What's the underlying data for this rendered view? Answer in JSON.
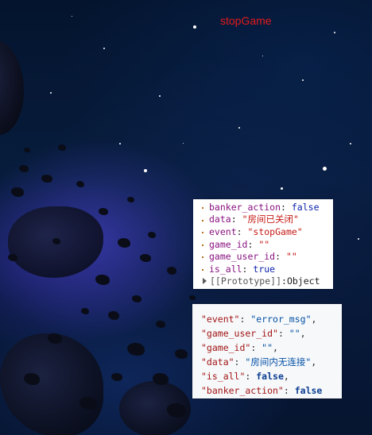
{
  "title": "stopGame",
  "console_object": {
    "rows": [
      {
        "key": "banker_action",
        "value": "false",
        "type": "bool"
      },
      {
        "key": "data",
        "value": "\"房间已关闭\"",
        "type": "str"
      },
      {
        "key": "event",
        "value": "\"stopGame\"",
        "type": "str"
      },
      {
        "key": "game_id",
        "value": "\"\"",
        "type": "str"
      },
      {
        "key": "game_user_id",
        "value": "\"\"",
        "type": "str"
      },
      {
        "key": "is_all",
        "value": "true",
        "type": "bool"
      }
    ],
    "prototype_label": "[[Prototype]]",
    "prototype_value": "Object"
  },
  "json_snippet": {
    "rows": [
      {
        "key": "\"event\"",
        "value": "\"error_msg\"",
        "type": "str",
        "trail": ","
      },
      {
        "key": "\"game_user_id\"",
        "value": "\"\"",
        "type": "str",
        "trail": ","
      },
      {
        "key": "\"game_id\"",
        "value": "\"\"",
        "type": "str",
        "trail": ","
      },
      {
        "key": "\"data\"",
        "value": "\"房间内无连接\"",
        "type": "str",
        "trail": ","
      },
      {
        "key": "\"is_all\"",
        "value": "false",
        "type": "bool",
        "trail": ","
      },
      {
        "key": "\"banker_action\"",
        "value": "false",
        "type": "bool",
        "trail": ""
      }
    ]
  },
  "colors": {
    "title": "#e41a1a",
    "background": "#071c3c"
  }
}
